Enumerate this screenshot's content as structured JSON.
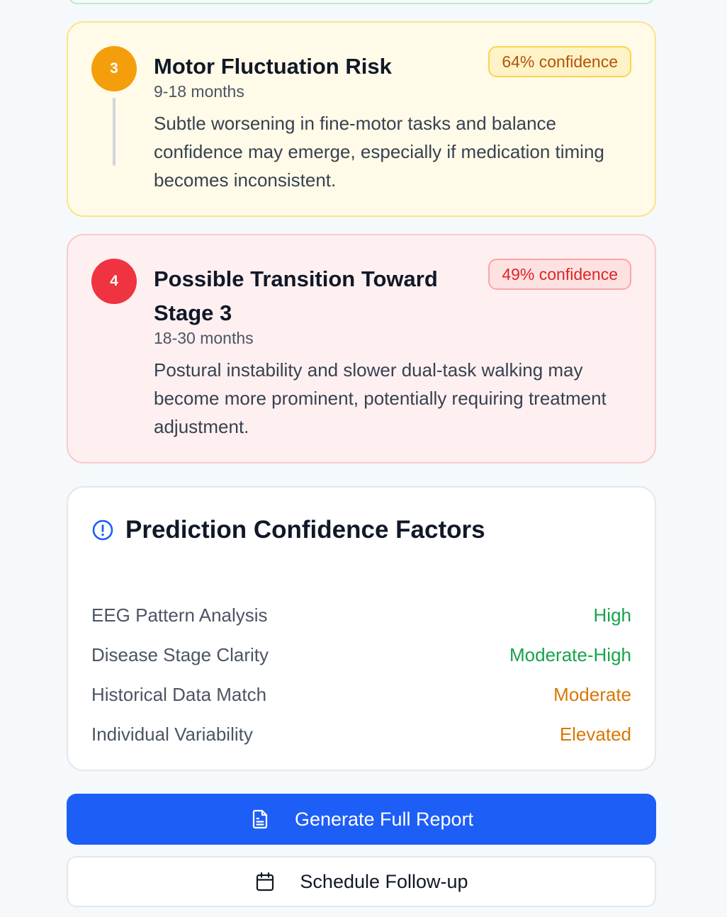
{
  "predictions": [
    {
      "step": "3",
      "title": "Motor Fluctuation Risk",
      "timeframe": "9-18 months",
      "confidence": "64% confidence",
      "description": "Subtle worsening in fine-motor tasks and balance confidence may emerge, especially if medication timing becomes inconsistent.",
      "accent_color": "#f59e0b"
    },
    {
      "step": "4",
      "title": "Possible Transition Toward Stage 3",
      "timeframe": "18-30 months",
      "confidence": "49% confidence",
      "description": "Postural instability and slower dual-task walking may become more prominent, potentially requiring treatment adjustment.",
      "accent_color": "#ef3340"
    }
  ],
  "confidence_factors": {
    "title": "Prediction Confidence Factors",
    "icon": "info-circle-icon",
    "items": [
      {
        "label": "EEG Pattern Analysis",
        "value": "High",
        "color": "#16a34a"
      },
      {
        "label": "Disease Stage Clarity",
        "value": "Moderate-High",
        "color": "#16a34a"
      },
      {
        "label": "Historical Data Match",
        "value": "Moderate",
        "color": "#d97706"
      },
      {
        "label": "Individual Variability",
        "value": "Elevated",
        "color": "#d97706"
      }
    ]
  },
  "actions": {
    "generate_report_label": "Generate Full Report",
    "generate_report_icon": "document-icon",
    "schedule_followup_label": "Schedule Follow-up",
    "schedule_followup_icon": "calendar-icon"
  },
  "colors": {
    "primary": "#1d5ef7",
    "background": "#f5f9fb"
  }
}
